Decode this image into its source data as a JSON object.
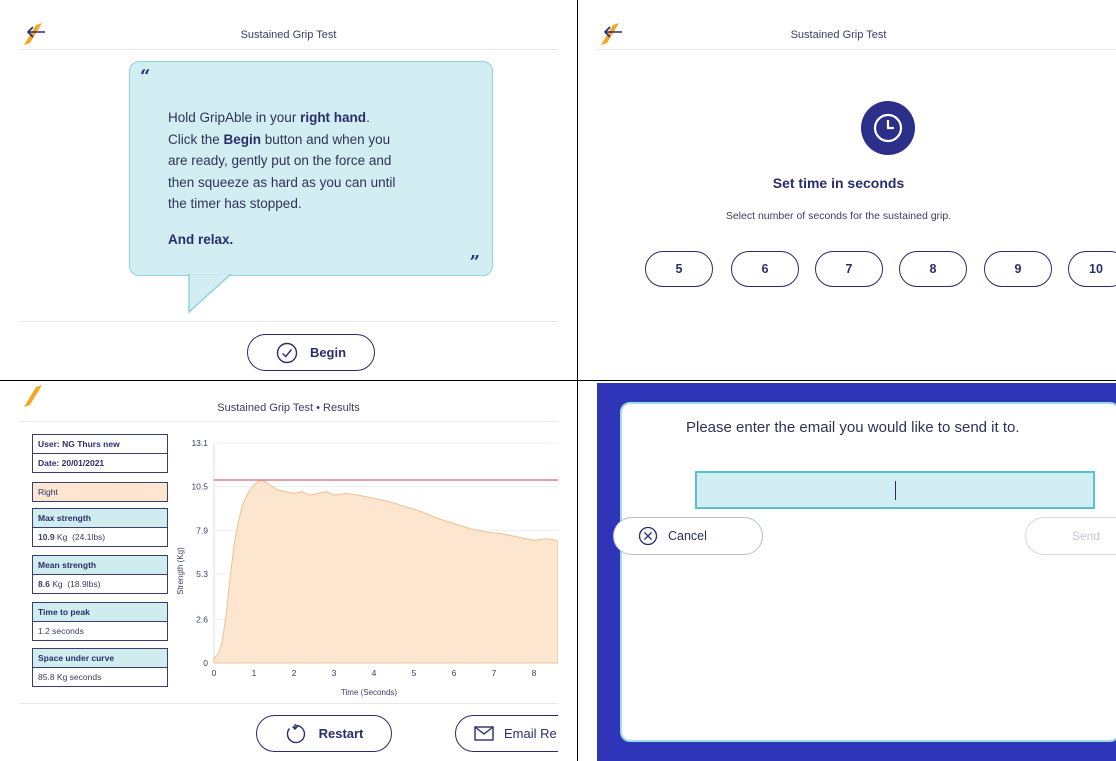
{
  "instructions_screen": {
    "title": "Sustained Grip Test",
    "line1_pre": "Hold GripAble in your ",
    "line1_bold": "right hand",
    "line1_post": ".",
    "line2_pre": "Click the ",
    "line2_bold": "Begin",
    "line2_post": " button and when you",
    "line3": "are ready, gently put on the force and",
    "line4": "then squeeze as hard as you can until",
    "line5": "the timer has stopped.",
    "relax": "And relax.",
    "open_quote": "“",
    "close_quote": "”",
    "begin_label": "Begin"
  },
  "time_screen": {
    "title": "Sustained Grip Test",
    "heading": "Set time in seconds",
    "subtitle": "Select number of seconds for the sustained grip.",
    "options": [
      "5",
      "6",
      "7",
      "8",
      "9",
      "10"
    ]
  },
  "results_screen": {
    "title": "Sustained Grip Test • Results",
    "user": "User: NG Thurs new",
    "date": "Date: 20/01/2021",
    "hand": "Right",
    "max_label": "Max strength",
    "max_value": "10.9",
    "max_unit": "Kg",
    "max_lbs": "(24.1lbs)",
    "mean_label": "Mean strength",
    "mean_value": "8.6",
    "mean_unit": "Kg",
    "mean_lbs": "(18.9lbs)",
    "peak_label": "Time to peak",
    "peak_value": "1.2 seconds",
    "area_label": "Space under curve",
    "area_value": "85.8 Kg seconds",
    "restart_label": "Restart",
    "email_label": "Email Re"
  },
  "chart_data": {
    "type": "area",
    "xlabel": "Time (Seconds)",
    "ylabel": "Strength (Kg)",
    "xlim": [
      0,
      8.6
    ],
    "ylim": [
      0,
      13.1
    ],
    "x_ticks": [
      "0",
      "1",
      "2",
      "3",
      "4",
      "5",
      "6",
      "7",
      "8"
    ],
    "y_ticks": [
      "0",
      "2.6",
      "5.3",
      "7.9",
      "10.5",
      "13.1"
    ],
    "reference_line": 10.9,
    "series": [
      {
        "x": [
          0,
          0.1,
          0.2,
          0.3,
          0.4,
          0.5,
          0.6,
          0.7,
          0.8,
          0.9,
          1.0,
          1.1,
          1.2,
          1.4,
          1.6,
          1.8,
          2.0,
          2.2,
          2.4,
          2.6,
          2.8,
          3.0,
          3.3,
          3.6,
          4.0,
          4.4,
          4.8,
          5.2,
          5.6,
          6.0,
          6.4,
          6.8,
          7.2,
          7.6,
          8.0,
          8.3,
          8.6
        ],
        "y": [
          0.3,
          0.5,
          1.2,
          2.8,
          5.0,
          7.0,
          8.3,
          9.3,
          9.9,
          10.3,
          10.6,
          10.8,
          10.9,
          10.6,
          10.3,
          10.2,
          10.1,
          10.2,
          10.0,
          10.1,
          10.2,
          10.0,
          10.1,
          10.0,
          9.8,
          9.6,
          9.3,
          9.0,
          8.6,
          8.3,
          8.0,
          7.8,
          7.7,
          7.5,
          7.3,
          7.4,
          7.3
        ],
        "color": "#fde6cf"
      }
    ],
    "line_color": "#f0c090",
    "reference_color": "#e07a90",
    "grid": true
  },
  "email_modal": {
    "prompt": "Please enter the email you would like to send it to.",
    "cancel_label": "Cancel",
    "send_label": "Send"
  },
  "colors": {
    "brand_navy": "#2a2d6b",
    "bubble_teal": "#d3eef2",
    "accent_orange": "#f5a623",
    "modal_backdrop": "#2f35b8"
  }
}
